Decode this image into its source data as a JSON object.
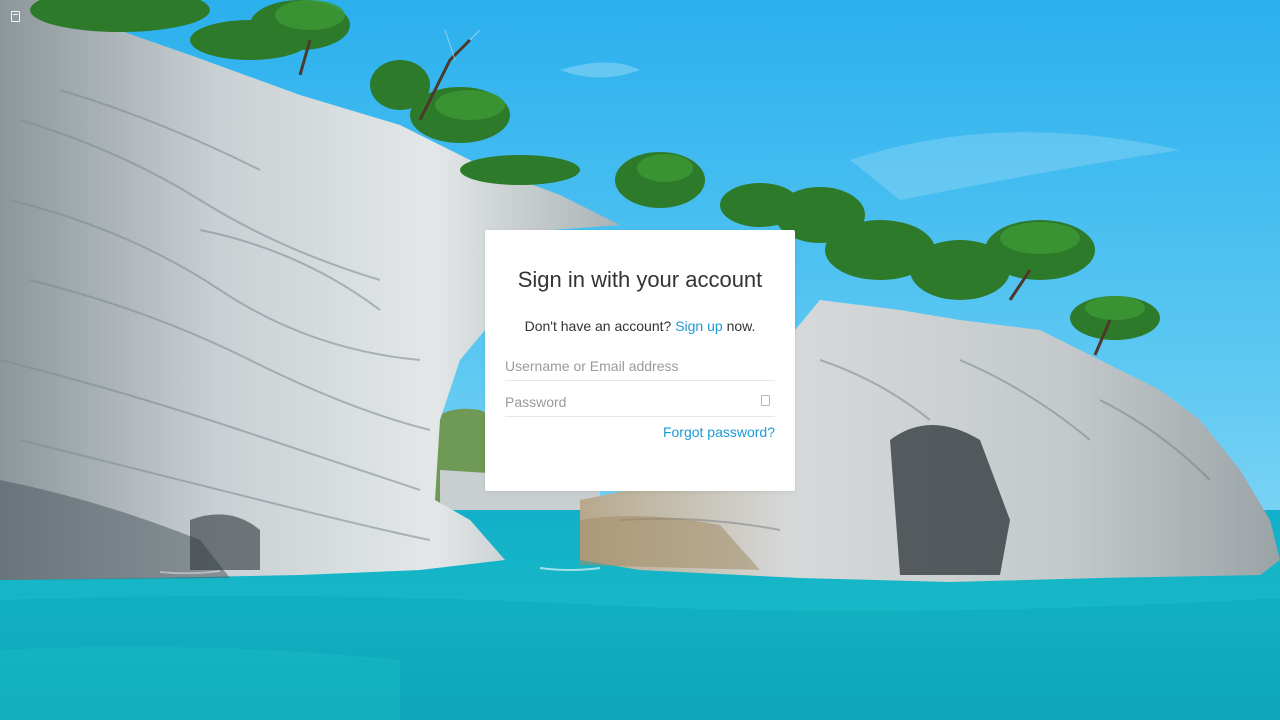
{
  "background": {
    "description_colors": {
      "sky": "#4fc3ee",
      "sea": "#17b4c8",
      "rock": "#d9dee0",
      "foliage": "#2f7d2a"
    }
  },
  "top_left_icon": "page-icon",
  "login": {
    "title": "Sign in with your account",
    "signup_prefix": "Don't have an account?",
    "signup_link": "Sign up",
    "signup_suffix": "now.",
    "username_placeholder": "Username or Email address",
    "password_placeholder": "Password",
    "password_toggle_icon": "show-password-icon",
    "forgot_password": "Forgot password?",
    "link_color": "#1a9ad6"
  }
}
